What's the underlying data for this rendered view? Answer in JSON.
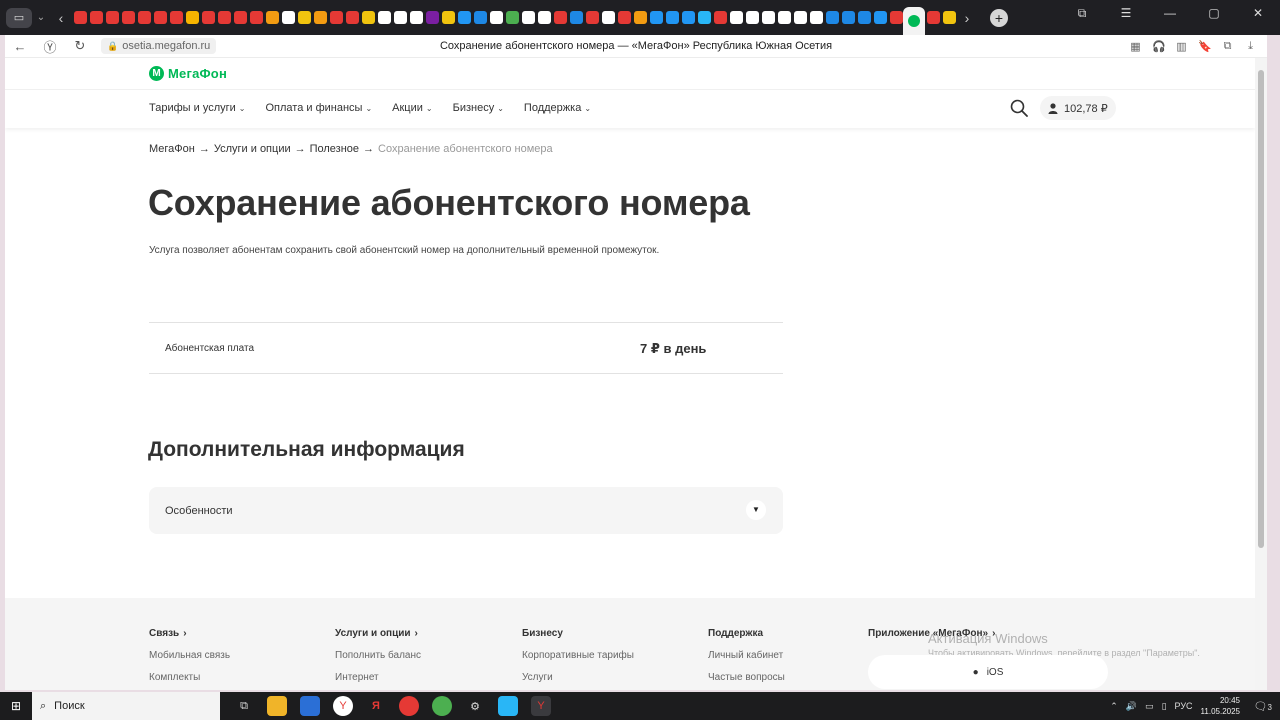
{
  "browser": {
    "url": "osetia.megafon.ru",
    "title": "Сохранение абонентского номера — «МегаФон» Республика Южная Осетия",
    "tab_colors": [
      "#e53935",
      "#e53935",
      "#e53935",
      "#e53935",
      "#e53935",
      "#e53935",
      "#e53935",
      "#f6b400",
      "#e53935",
      "#e53935",
      "#e53935",
      "#e53935",
      "#f39c12",
      "#ffffff",
      "#f1c40f",
      "#f39c12",
      "#e53935",
      "#e53935",
      "#f1c40f",
      "#ffffff",
      "#ffffff",
      "#ffffff",
      "#7b1fa2",
      "#f1c40f",
      "#2196f3",
      "#1e88e5",
      "#ffffff",
      "#4caf50",
      "#ffffff",
      "#ffffff",
      "#e53935",
      "#1e88e5",
      "#e53935",
      "#ffffff",
      "#e53935",
      "#f39c12",
      "#2196f3",
      "#2196f3",
      "#2196f3",
      "#29b6f6",
      "#e53935",
      "#ffffff",
      "#ffffff",
      "#ffffff",
      "#ffffff",
      "#ffffff",
      "#ffffff",
      "#1e88e5",
      "#1e88e5",
      "#1e88e5",
      "#2196f3",
      "#e53935"
    ],
    "accent": "#00b956"
  },
  "site": {
    "logo_text": "МегаФон",
    "nav": [
      "Тарифы и услуги",
      "Оплата и финансы",
      "Акции",
      "Бизнесу",
      "Поддержка"
    ],
    "balance": "102,78 ₽"
  },
  "breadcrumb": {
    "items": [
      "МегаФон",
      "Услуги и опции",
      "Полезное"
    ],
    "separator": "→",
    "current": "Сохранение абонентского номера"
  },
  "page": {
    "title": "Сохранение абонентского номера",
    "description": "Услуга позволяет абонентам сохранить свой абонентский номер на дополнительный временной промежуток.",
    "fee_label": "Абонентская плата",
    "fee_value": "7 ₽ в день",
    "section_title": "Дополнительная информация",
    "accordion_label": "Особенности"
  },
  "footer": {
    "col1": {
      "title": "Связь",
      "links": [
        "Мобильная связь",
        "Комплекты"
      ]
    },
    "col2": {
      "title": "Услуги и опции",
      "links": [
        "Пополнить баланс",
        "Интернет"
      ]
    },
    "col3": {
      "title": "Бизнесу",
      "links": [
        "Корпоративные тарифы",
        "Услуги"
      ]
    },
    "col4": {
      "title": "Поддержка",
      "links": [
        "Личный кабинет",
        "Частые вопросы"
      ]
    },
    "app_title": "Приложение «МегаФон»",
    "ios_label": "iOS",
    "watermark_title": "Активация Windows",
    "watermark_text": "Чтобы активировать Windows, перейдите в раздел \"Параметры\"."
  },
  "taskbar": {
    "search": "Поиск",
    "lang": "РУС",
    "time": "20:45",
    "date": "11.05.2025",
    "notifications": "3"
  }
}
